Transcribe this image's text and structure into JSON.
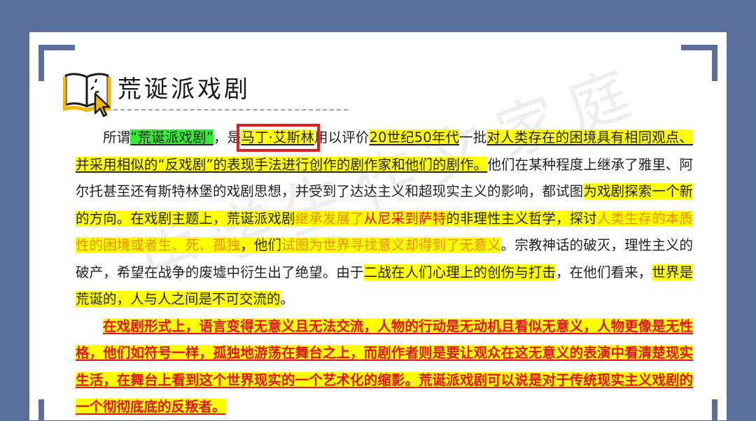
{
  "header": {
    "title": "荒诞派戏剧",
    "icon": "open-book-cursor-icon"
  },
  "watermark": "中学生作文家庭",
  "paragraph1": {
    "s1": "所谓",
    "s2": "“荒诞派戏剧”",
    "s3": "，是",
    "s4": "马丁·艾斯林",
    "s5": "用以评价",
    "s6": "20世纪50年代",
    "s7": "一批",
    "s8": "对人类存在的困境具有相同观点、并采用相似的“反戏剧”的表现手法进行创作的剧作家和他们的剧作。",
    "s9": "他们在某种程度上继承了雅里、阿尔托甚至还有斯特林堡的戏剧思想，并受到了达达主义和超现实主义的影响，都试图",
    "s10": "为戏剧探索一个新的方向。",
    "s11": "在戏剧主题上，荒诞派戏剧",
    "s12": "继承发展了",
    "s13": "从尼采到萨特",
    "s14": "的非理性主义哲学，",
    "s15": "探讨",
    "s16": "人类生存的本质性的困境或者生、死、孤独",
    "s17": "，他们",
    "s18": "试图为世界寻找意义却得到了无意义",
    "s19": "。宗教神话的破灭，理性主义的破产，希望在战争的废墟中衍生出了绝望。由于",
    "s20": "二战在人们心理上的创伤与打击",
    "s21": "，在他们看来，",
    "s22": "世界是荒诞的，人与人之间是不可交流的",
    "s23": "。"
  },
  "paragraph2": {
    "text": "在戏剧形式上，语言变得无意义且无法交流，人物的行动是无动机且看似无意义，人物更像是无性格，他们如符号一样，孤独地游荡在舞台之上，而剧作者则是要让观众在这无意义的表演中看清楚现实生活，在舞台上看到这个世界现实的一个艺术化的缩影。荒诞派戏剧可以说是对于传统现实主义戏剧的一个彻彻底底的反叛者。"
  },
  "colors": {
    "background": "#5a6f9c",
    "highlight_yellow": "#ffff00",
    "highlight_green": "#33ee33",
    "orange_text": "#f28a00",
    "red_text": "#e8101a",
    "red_box": "#e02020"
  }
}
